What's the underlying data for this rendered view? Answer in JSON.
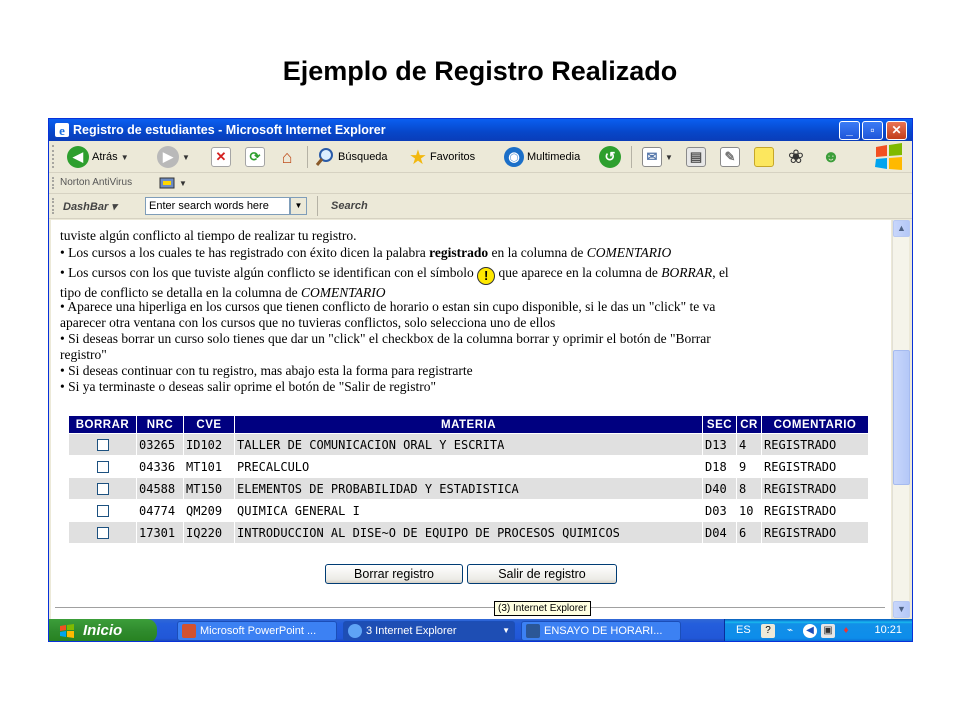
{
  "slide": {
    "title": "Ejemplo de Registro Realizado"
  },
  "window": {
    "title": "Registro de estudiantes - Microsoft Internet Explorer",
    "controls": {
      "minimize": "_",
      "maximize": "▫",
      "close": "✕"
    }
  },
  "toolbar": {
    "back_label": "Atrás",
    "search_label": "Búsqueda",
    "favorites_label": "Favoritos",
    "media_label": "Multimedia"
  },
  "norton": {
    "label": "Norton AntiVirus"
  },
  "dashbar": {
    "label": "DashBar",
    "search_placeholder": "Enter search words here",
    "search_button": "Search"
  },
  "content": {
    "lines": [
      "tuviste algún conflicto al tiempo de realizar tu registro.",
      {
        "bullet": "•",
        "before": " Los cursos a los cuales te has registrado con éxito dicen la palabra ",
        "bold": "registrado",
        "middle": " en la columna de ",
        "italic": "COMENTARIO"
      },
      {
        "bullet": "•",
        "before": " Los cursos con los que tuviste algún conflicto se identifican con el símbolo ",
        "icon": "!",
        "after": " que aparece en la columna de ",
        "italic": "BORRAR",
        "tail": ", el",
        "line2": "tipo de conflicto se detalla en la columna de ",
        "italic2": "COMENTARIO"
      },
      {
        "bullet": "•",
        "text": " Aparece una hiperliga en los cursos que tienen conflicto de horario o estan sin cupo disponible, si le das un \"click\" te va",
        "line2": "aparecer otra ventana con los cursos que no tuvieras conflictos, solo selecciona uno de ellos"
      },
      {
        "bullet": "•",
        "text": " Si deseas borrar un curso solo tienes que dar un \"click\" el checkbox de la columna borrar y oprimir el botón de \"Borrar",
        "line2": "registro\""
      },
      {
        "bullet": "•",
        "text": " Si deseas continuar con tu registro, mas abajo esta la forma para registrarte"
      },
      {
        "bullet": "•",
        "text": " Si ya terminaste o deseas salir oprime el botón de \"Salir de registro\""
      }
    ]
  },
  "table": {
    "headers": [
      "BORRAR",
      "NRC",
      "CVE",
      "MATERIA",
      "SEC",
      "CR",
      "COMENTARIO"
    ],
    "rows": [
      {
        "nrc": "03265",
        "cve": "ID102",
        "materia": "TALLER DE COMUNICACION ORAL Y ESCRITA",
        "sec": "D13",
        "cr": "4",
        "comentario": "REGISTRADO"
      },
      {
        "nrc": "04336",
        "cve": "MT101",
        "materia": "PRECALCULO",
        "sec": "D18",
        "cr": "9",
        "comentario": "REGISTRADO"
      },
      {
        "nrc": "04588",
        "cve": "MT150",
        "materia": "ELEMENTOS DE PROBABILIDAD Y ESTADISTICA",
        "sec": "D40",
        "cr": "8",
        "comentario": "REGISTRADO"
      },
      {
        "nrc": "04774",
        "cve": "QM209",
        "materia": "QUIMICA GENERAL I",
        "sec": "D03",
        "cr": "10",
        "comentario": "REGISTRADO"
      },
      {
        "nrc": "17301",
        "cve": "IQ220",
        "materia": "INTRODUCCION AL DISE~O DE EQUIPO DE PROCESOS QUIMICOS",
        "sec": "D04",
        "cr": "6",
        "comentario": "REGISTRADO"
      }
    ]
  },
  "buttons": {
    "delete": "Borrar registro",
    "exit": "Salir de registro"
  },
  "tooltip": "(3) Internet Explorer",
  "taskbar": {
    "start": "Inicio",
    "items": [
      "Microsoft PowerPoint ...",
      "3 Internet Explorer",
      "ENSAYO DE HORARI..."
    ],
    "language": "ES",
    "clock": "10:21"
  },
  "colors": {
    "header_bg": "#000080",
    "titlebar": "#0A5FF0",
    "taskbar": "#245EDC",
    "start": "#3C9E3A"
  }
}
